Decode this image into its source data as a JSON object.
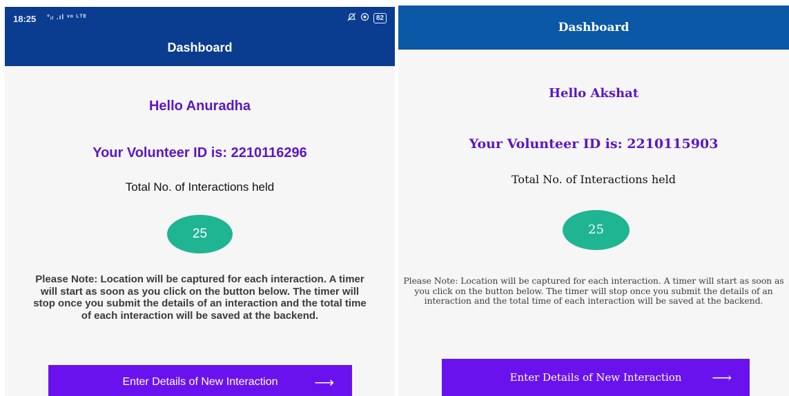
{
  "left": {
    "status": {
      "time": "18:25",
      "signal_text": "°ᵢₗ .ıl ᵛᵒ ᴸᵀᴱ",
      "battery": "82"
    },
    "app_title": "Dashboard",
    "greeting": "Hello Anuradha",
    "volunteer_id_text": "Your Volunteer ID is: 2210116296",
    "total_label": "Total No. of Interactions held",
    "count": "25",
    "note": "Please Note: Location will be captured for each interaction. A timer will start as soon as you click on the button below. The timer will stop once you submit the details of an interaction and the total time of each interaction will be saved at the backend.",
    "cta_label": "Enter Details of New Interaction",
    "cta_arrow": "⟶"
  },
  "right": {
    "app_title": "Dashboard",
    "greeting": "Hello Akshat",
    "volunteer_id_text": "Your Volunteer ID is: 2210115903",
    "total_label": "Total No. of Interactions held",
    "count": "25",
    "note": "Please Note: Location will be captured for each interaction. A timer will start as soon as you click on the button below. The timer will stop once you submit the details of an interaction and the total time of each interaction will be saved at the backend.",
    "cta_label": "Enter Details of New Interaction",
    "cta_arrow": "⟶"
  },
  "colors": {
    "appbar_left": "#0a3c8f",
    "appbar_right": "#0a58a6",
    "accent_purple": "#5b16c4",
    "button": "#6a12ee",
    "count_circle": "#1fb592"
  },
  "icons": [
    "mute-icon",
    "alarm-icon",
    "battery-icon",
    "arrow-right-icon"
  ]
}
